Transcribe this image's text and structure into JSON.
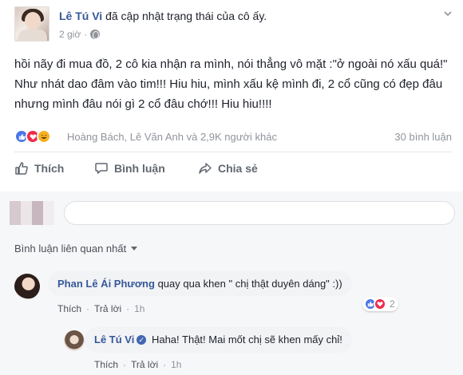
{
  "post": {
    "author": "Lê Tú Vi",
    "action": "đã cập nhật trạng thái của cô ấy.",
    "time": "2 giờ",
    "text": "hồi nãy đi mua đồ, 2 cô kia nhận ra mình, nói thẳng vô mặt :\"ở ngoài nó xấu quá!\" Như nhát dao đâm vào tim!!! Hiu hiu, mình xấu kệ mình đi, 2 cổ cũng có đẹp đâu nhưng mình đâu nói gì 2 cổ đâu chớ!!! Hiu hiu!!!!"
  },
  "reactions": {
    "icons": [
      "like-icon",
      "love-icon",
      "haha-icon"
    ],
    "people": "Hoàng Bách, Lê Văn Anh và 2,9K người khác",
    "comments": "30 bình luận"
  },
  "actions": {
    "like": "Thích",
    "comment": "Bình luận",
    "share": "Chia sẻ"
  },
  "comments_section": {
    "sort_label": "Bình luận liên quan nhất",
    "comments": [
      {
        "name": "Phan Lê Ái Phương",
        "text": "quay qua khen \" chị thật duyên dáng\" :))",
        "like": "Thích",
        "reply": "Trả lời",
        "time": "1h",
        "reaction_count": "2"
      },
      {
        "name": "Lê Tú Vi",
        "text": "Haha! Thật! Mai mốt chị sẽ khen mấy chỉ!",
        "like": "Thích",
        "reply": "Trả lời",
        "time": "1h"
      }
    ]
  },
  "colors": {
    "link_blue": "#365899",
    "muted": "#90949c",
    "like_blue": "#4a76e8",
    "love_red": "#f0284a",
    "haha_yellow": "#f7b125"
  }
}
